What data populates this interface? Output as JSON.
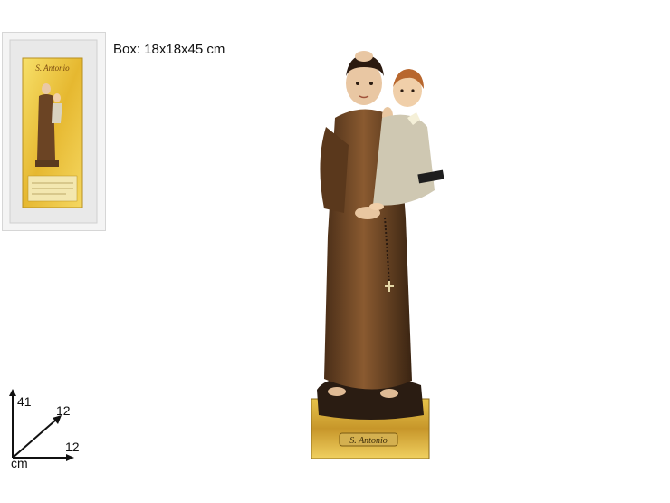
{
  "box_caption": "Box: 18x18x45 cm",
  "box_label": "S. Antonio",
  "statue_plaque": "S. Antonio",
  "dimensions": {
    "height": "41",
    "depth": "12",
    "width": "12",
    "unit": "cm"
  }
}
